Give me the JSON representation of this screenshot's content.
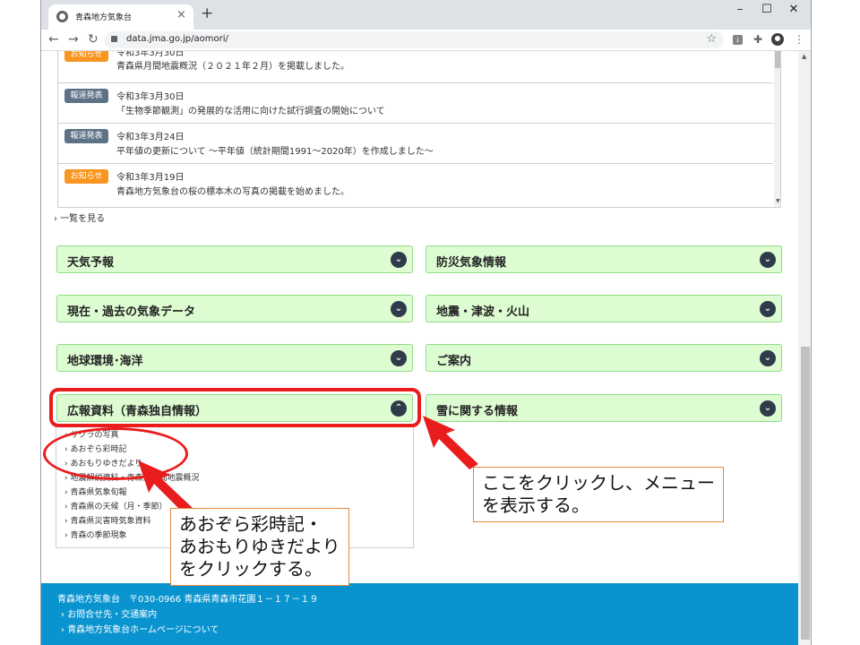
{
  "browser": {
    "tab_title": "青森地方気象台",
    "tab_close": "×",
    "new_tab": "+",
    "win_minimize": "–",
    "win_maximize": "☐",
    "win_close": "✕",
    "back": "←",
    "forward": "→",
    "reload": "↻",
    "url": "data.jma.go.jp/aomori/",
    "star": "☆",
    "menu": "⋮",
    "icons": [
      "lock-icon",
      "star-icon",
      "pdf-extension-icon",
      "puzzle-extension-icon",
      "profile-icon",
      "kebab-menu-icon"
    ]
  },
  "news": {
    "items": [
      {
        "badge": "お知らせ",
        "badge_color": "#f79620",
        "date": "令和3年3月30日",
        "title": "青森県月間地震概況（２０２１年２月）を掲載しました。"
      },
      {
        "badge": "報道発表",
        "badge_color": "#5e7287",
        "date": "令和3年3月30日",
        "title": "「生物季節観測」の発展的な活用に向けた試行調査の開始について"
      },
      {
        "badge": "報道発表",
        "badge_color": "#5e7287",
        "date": "令和3年3月24日",
        "title": "平年値の更新について ～平年値（統計期間1991～2020年）を作成しました～"
      },
      {
        "badge": "お知らせ",
        "badge_color": "#f79620",
        "date": "令和3年3月19日",
        "title": "青森地方気象台の桜の標本木の写真の掲載を始めました。"
      }
    ],
    "more_link": "一覧を見る"
  },
  "categories": {
    "left": [
      {
        "label": "天気予報",
        "icon": "chevron-down"
      },
      {
        "label": "現在・過去の気象データ",
        "icon": "chevron-down"
      },
      {
        "label": "地球環境･海洋",
        "icon": "chevron-down"
      },
      {
        "label": "広報資料（青森独自情報）",
        "icon": "chevron-up"
      }
    ],
    "right": [
      {
        "label": "防災気象情報",
        "icon": "chevron-down"
      },
      {
        "label": "地震・津波・火山",
        "icon": "chevron-down"
      },
      {
        "label": "ご案内",
        "icon": "chevron-down"
      },
      {
        "label": "雪に関する情報",
        "icon": "chevron-down"
      }
    ],
    "down_glyph": "⌄",
    "up_glyph": "⌃"
  },
  "submenu": {
    "items": [
      "サクラの写真",
      "あおぞら彩時記",
      "あおもりゆきだより",
      "地震解説資料・青森県月間地震概況",
      "青森県気象旬報",
      "青森県の天候（月・季節）",
      "青森県災害時気象資料",
      "青森の季節現象"
    ]
  },
  "footer": {
    "name": "青森地方気象台",
    "address": "〒030-0966 青森県青森市花園１－１７－１９",
    "links": [
      "お問合せ先・交通案内",
      "青森地方気象台ホームページについて"
    ]
  },
  "annotations": {
    "callout_right": [
      "ここをクリックし、メニュー",
      "を表示する。"
    ],
    "callout_left": [
      "あおぞら彩時記・",
      "あおもりゆきだより",
      "をクリックする。"
    ],
    "highlight_color": "#ea1d1d"
  }
}
